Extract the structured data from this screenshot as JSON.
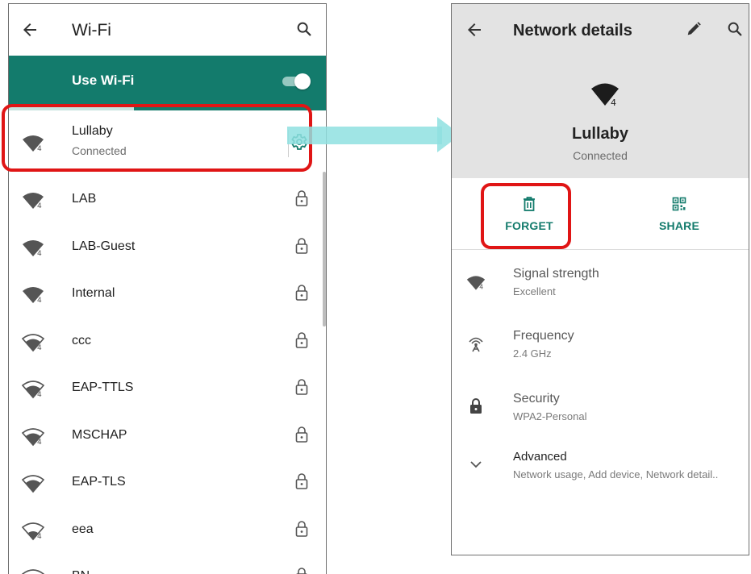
{
  "left_screen": {
    "title": "Wi-Fi",
    "use_wifi_label": "Use Wi-Fi",
    "use_wifi_enabled": true,
    "networks": [
      {
        "name": "Lullaby",
        "status": "Connected",
        "icon": "wifi-signal-full-icon",
        "action_icon": "gear-icon"
      },
      {
        "name": "LAB",
        "status": "",
        "icon": "wifi-signal-full-icon",
        "action_icon": "lock-icon"
      },
      {
        "name": "LAB-Guest",
        "status": "",
        "icon": "wifi-signal-full-icon",
        "action_icon": "lock-icon"
      },
      {
        "name": "Internal",
        "status": "",
        "icon": "wifi-signal-full-icon",
        "action_icon": "lock-icon"
      },
      {
        "name": "ccc",
        "status": "",
        "icon": "wifi-signal-medium-icon",
        "action_icon": "lock-icon"
      },
      {
        "name": "EAP-TTLS",
        "status": "",
        "icon": "wifi-signal-medium-icon",
        "action_icon": "lock-icon"
      },
      {
        "name": "MSCHAP",
        "status": "",
        "icon": "wifi-signal-medium-icon",
        "action_icon": "lock-icon"
      },
      {
        "name": "EAP-TLS",
        "status": "",
        "icon": "wifi-signal-medium-icon",
        "action_icon": "lock-icon"
      },
      {
        "name": "eea",
        "status": "",
        "icon": "wifi-signal-low-icon",
        "action_icon": "lock-icon"
      },
      {
        "name": "BN",
        "status": "",
        "icon": "wifi-signal-low-icon",
        "action_icon": "lock-icon"
      }
    ]
  },
  "right_screen": {
    "title": "Network details",
    "network_name": "Lullaby",
    "network_status": "Connected",
    "actions": {
      "forget_label": "FORGET",
      "share_label": "SHARE"
    },
    "details": {
      "signal": {
        "label": "Signal strength",
        "value": "Excellent"
      },
      "frequency": {
        "label": "Frequency",
        "value": "2.4 GHz"
      },
      "security": {
        "label": "Security",
        "value": "WPA2-Personal"
      },
      "advanced": {
        "label": "Advanced",
        "value": "Network usage, Add device, Network detail.."
      }
    }
  },
  "colors": {
    "accent": "#137b6c",
    "highlight": "#e01515",
    "arrow": "#8fe0e0",
    "header_gray": "#e3e3e3"
  }
}
